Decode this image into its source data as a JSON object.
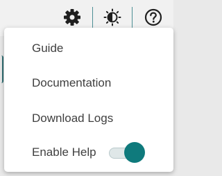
{
  "toolbar": {
    "icons": [
      "gear-icon",
      "brightness-icon",
      "help-icon"
    ],
    "icon_color": "#1f1f1f",
    "separator_color": "#4b8f94"
  },
  "menu": {
    "items": [
      {
        "label": "Guide"
      },
      {
        "label": "Documentation"
      },
      {
        "label": "Download Logs"
      }
    ],
    "enable_help": {
      "label": "Enable Help",
      "enabled": true,
      "accent_color": "#0f7a7c"
    }
  }
}
